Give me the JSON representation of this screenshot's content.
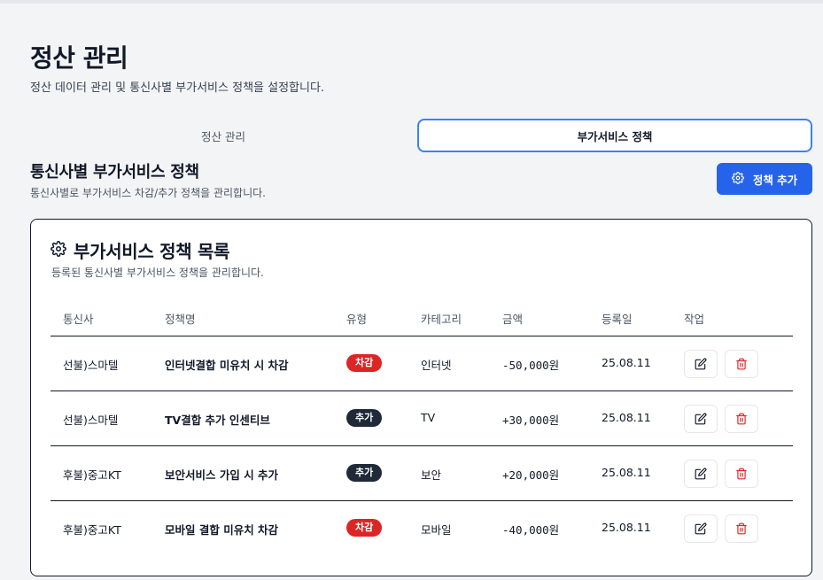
{
  "page": {
    "title": "정산 관리",
    "subtitle": "정산 데이터 관리 및 통신사별 부가서비스 정책을 설정합니다."
  },
  "tabs": [
    {
      "label": "정산 관리",
      "active": false
    },
    {
      "label": "부가서비스 정책",
      "active": true
    }
  ],
  "section": {
    "title": "통신사별 부가서비스 정책",
    "subtitle": "통신사별로 부가서비스 차감/추가 정책을 관리합니다.",
    "add_button": "정책 추가"
  },
  "card": {
    "title": "부가서비스 정책 목록",
    "subtitle": "등록된 통신사별 부가서비스 정책을 관리합니다."
  },
  "table": {
    "columns": [
      "통신사",
      "정책명",
      "유형",
      "카테고리",
      "금액",
      "등록일",
      "작업"
    ],
    "rows": [
      {
        "carrier": "선불)스마텔",
        "policy": "인터넷결합 미유치 시 차감",
        "type": "차감",
        "category": "인터넷",
        "amount": "-50,000원",
        "date": "25.08.11"
      },
      {
        "carrier": "선불)스마텔",
        "policy": "TV결합 추가 인센티브",
        "type": "추가",
        "category": "TV",
        "amount": "+30,000원",
        "date": "25.08.11"
      },
      {
        "carrier": "후불)중고KT",
        "policy": "보안서비스 가입 시 추가",
        "type": "추가",
        "category": "보안",
        "amount": "+20,000원",
        "date": "25.08.11"
      },
      {
        "carrier": "후불)중고KT",
        "policy": "모바일 결합 미유치 차감",
        "type": "차감",
        "category": "모바일",
        "amount": "-40,000원",
        "date": "25.08.11"
      }
    ]
  },
  "colors": {
    "accent": "#2563eb",
    "tab_border": "#3b82f6",
    "deduct_badge": "#dc2626",
    "add_badge": "#1f2937",
    "delete_icon": "#dc2626"
  },
  "icons": {
    "add_button": "gear-icon",
    "card_title": "gear-icon",
    "edit": "edit-icon",
    "delete": "trash-icon"
  }
}
